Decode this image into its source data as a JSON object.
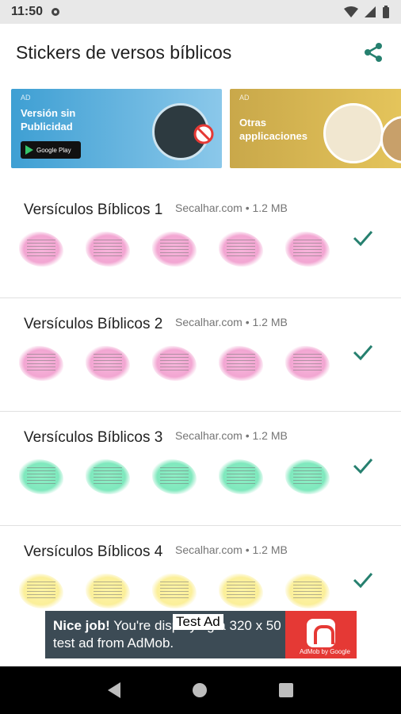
{
  "status": {
    "time": "11:50"
  },
  "app": {
    "title": "Stickers de versos bíblicos"
  },
  "banners": [
    {
      "ad": "AD",
      "text1": "Versión sin",
      "text2": "Publicidad",
      "badge": "Google Play"
    },
    {
      "ad": "AD",
      "text1": "Otras",
      "text2": "applicaciones"
    }
  ],
  "packs": [
    {
      "name": "Versículos Bíblicos 1",
      "meta": "Secalhar.com • 1.2 MB",
      "color": "pink"
    },
    {
      "name": "Versículos Bíblicos 2",
      "meta": "Secalhar.com • 1.2 MB",
      "color": "pink"
    },
    {
      "name": "Versículos Bíblicos 3",
      "meta": "Secalhar.com • 1.2 MB",
      "color": "green"
    },
    {
      "name": "Versículos Bíblicos 4",
      "meta": "Secalhar.com • 1.2 MB",
      "color": "yellow"
    }
  ],
  "ad": {
    "bold": "Nice job!",
    "text": " You're displaying a 320 x 50 test ad from AdMob.",
    "label": "Test Ad",
    "brand": "AdMob by Google"
  },
  "colors": {
    "accent": "#26a69a",
    "check": "#26806f"
  }
}
